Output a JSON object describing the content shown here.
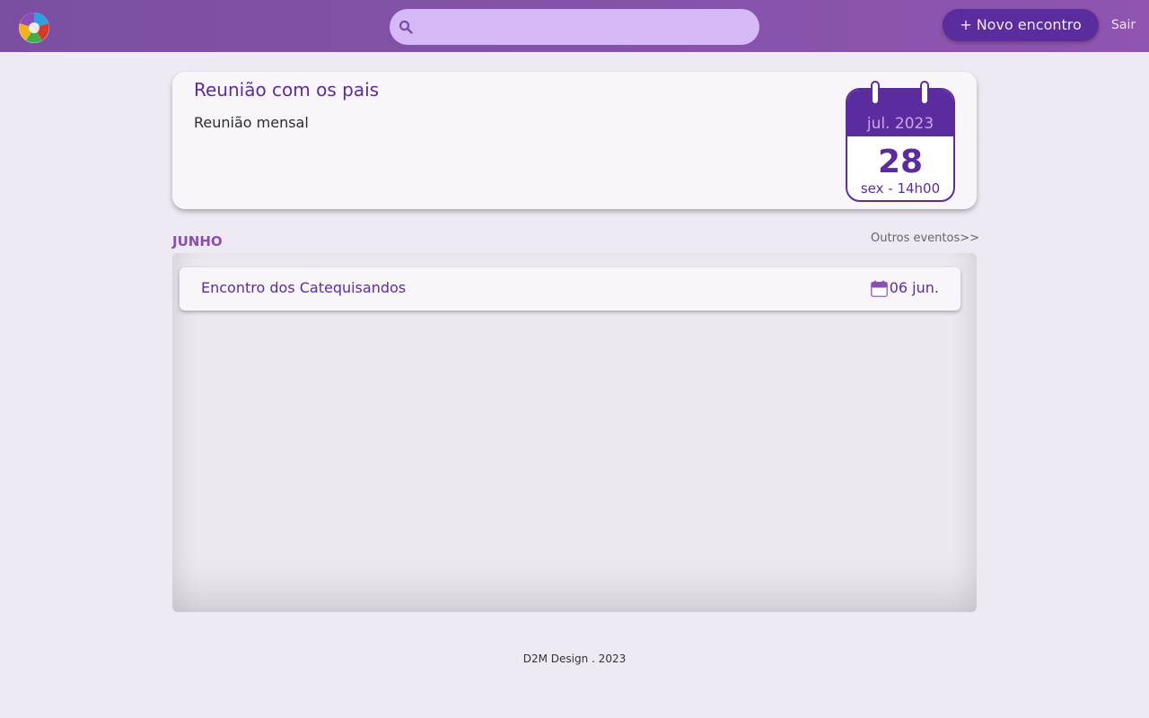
{
  "header": {
    "logo_name": "app-logo",
    "search": {
      "value": "",
      "placeholder": ""
    },
    "new_button_label": "+ Novo encontro",
    "logout_label": "Sair"
  },
  "featured_event": {
    "title": "Reunião com os pais",
    "description": "Reunião mensal",
    "calendar": {
      "month_year": "jul. 2023",
      "day": "28",
      "weekday_time": "sex - 14h00"
    }
  },
  "month_section": {
    "month_label": "JUNHO",
    "other_events_label": "Outros eventos>>",
    "events": [
      {
        "name": "Encontro dos Catequisandos",
        "date": "06 jun."
      }
    ]
  },
  "footer": {
    "text": "D2M Design . 2023"
  },
  "colors": {
    "primary": "#5b2c9e",
    "header_gradient_start": "#7a4fa3",
    "header_gradient_end": "#8f55b0",
    "search_bg": "#d5b8f6",
    "page_bg": "#efe9f3"
  }
}
